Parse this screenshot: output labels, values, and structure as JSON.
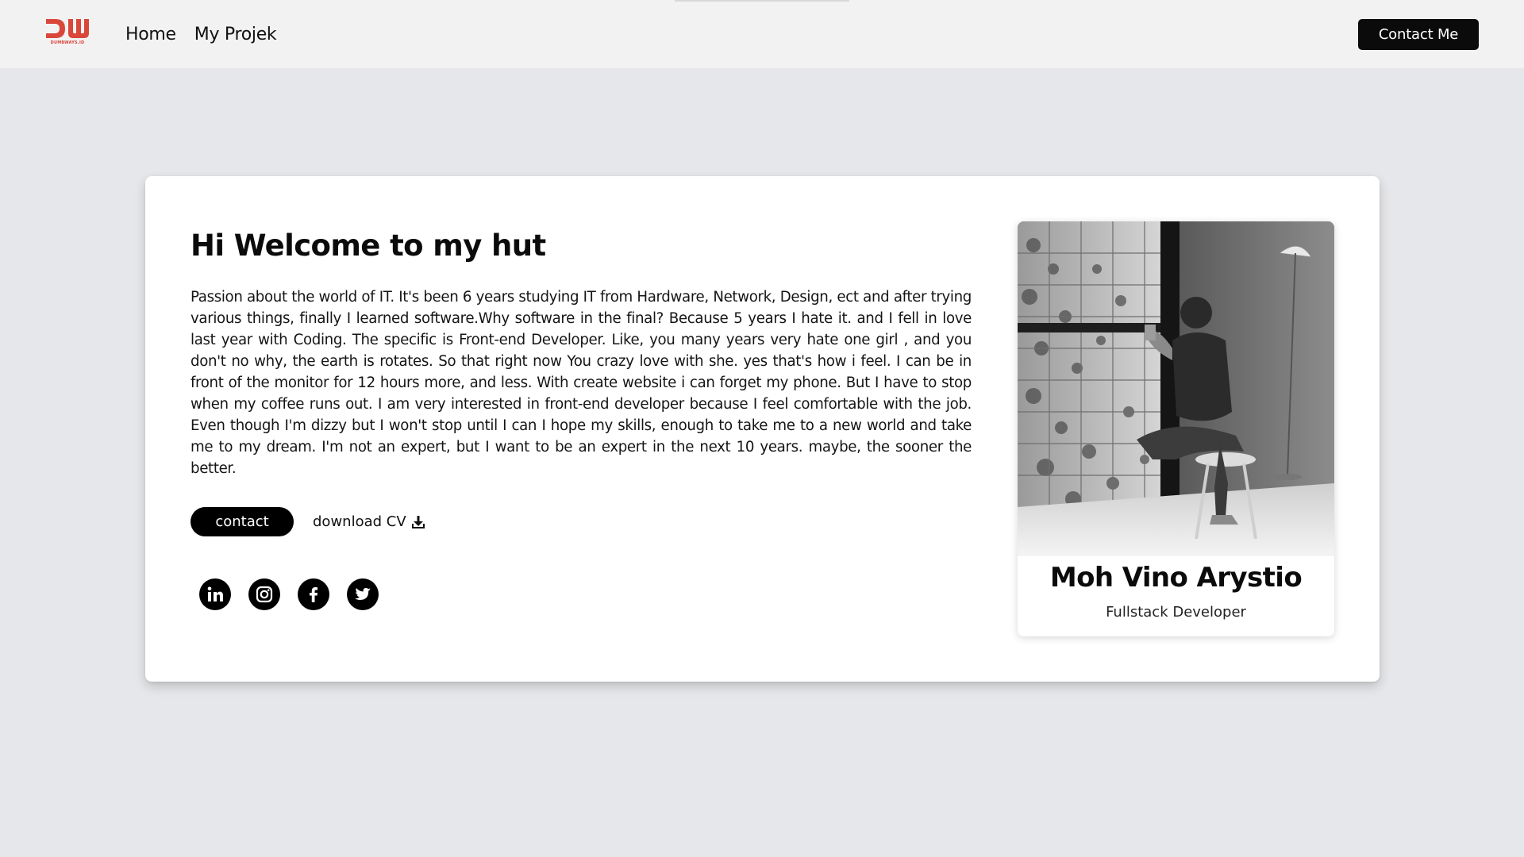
{
  "navbar": {
    "logo_text": "DUMBWAYS.ID",
    "links": [
      "Home",
      "My Projek"
    ],
    "contact_button": "Contact Me"
  },
  "hero": {
    "headline": "Hi Welcome to my hut",
    "bio": "Passion about the world of IT. It's been 6 years studying IT from Hardware, Network, Design, ect and after trying various things, finally I learned software.Why software in the final? Because 5 years I hate it. and I fell in love last year with Coding. The specific is Front-end Developer. Like, you many years very hate one girl , and you don't no why, the earth is rotates. So that right now You crazy love with she. yes that's how i feel. I can be in front of the monitor for 12 hours more, and less. With create website i can forget my phone. But I have to stop when my coffee runs out. I am very interested in front-end developer because I feel comfortable with the job. Even though I'm dizzy but I won't stop until I can I hope my skills, enough to take me to a new world and take me to my dream. I'm not an expert, but I want to be an expert in the next 10 years. maybe, the sooner the better.",
    "contact_button": "contact",
    "download_label": "download CV",
    "socials": [
      "linkedin-icon",
      "instagram-icon",
      "facebook-icon",
      "twitter-icon"
    ]
  },
  "profile": {
    "name": "Moh Vino Arystio",
    "role": "Fullstack Developer"
  },
  "colors": {
    "page_bg": "#e6e7ea",
    "navbar_bg": "#f3f2f3",
    "brand_red": "#d9463a",
    "button_bg": "#0b0b0b"
  }
}
